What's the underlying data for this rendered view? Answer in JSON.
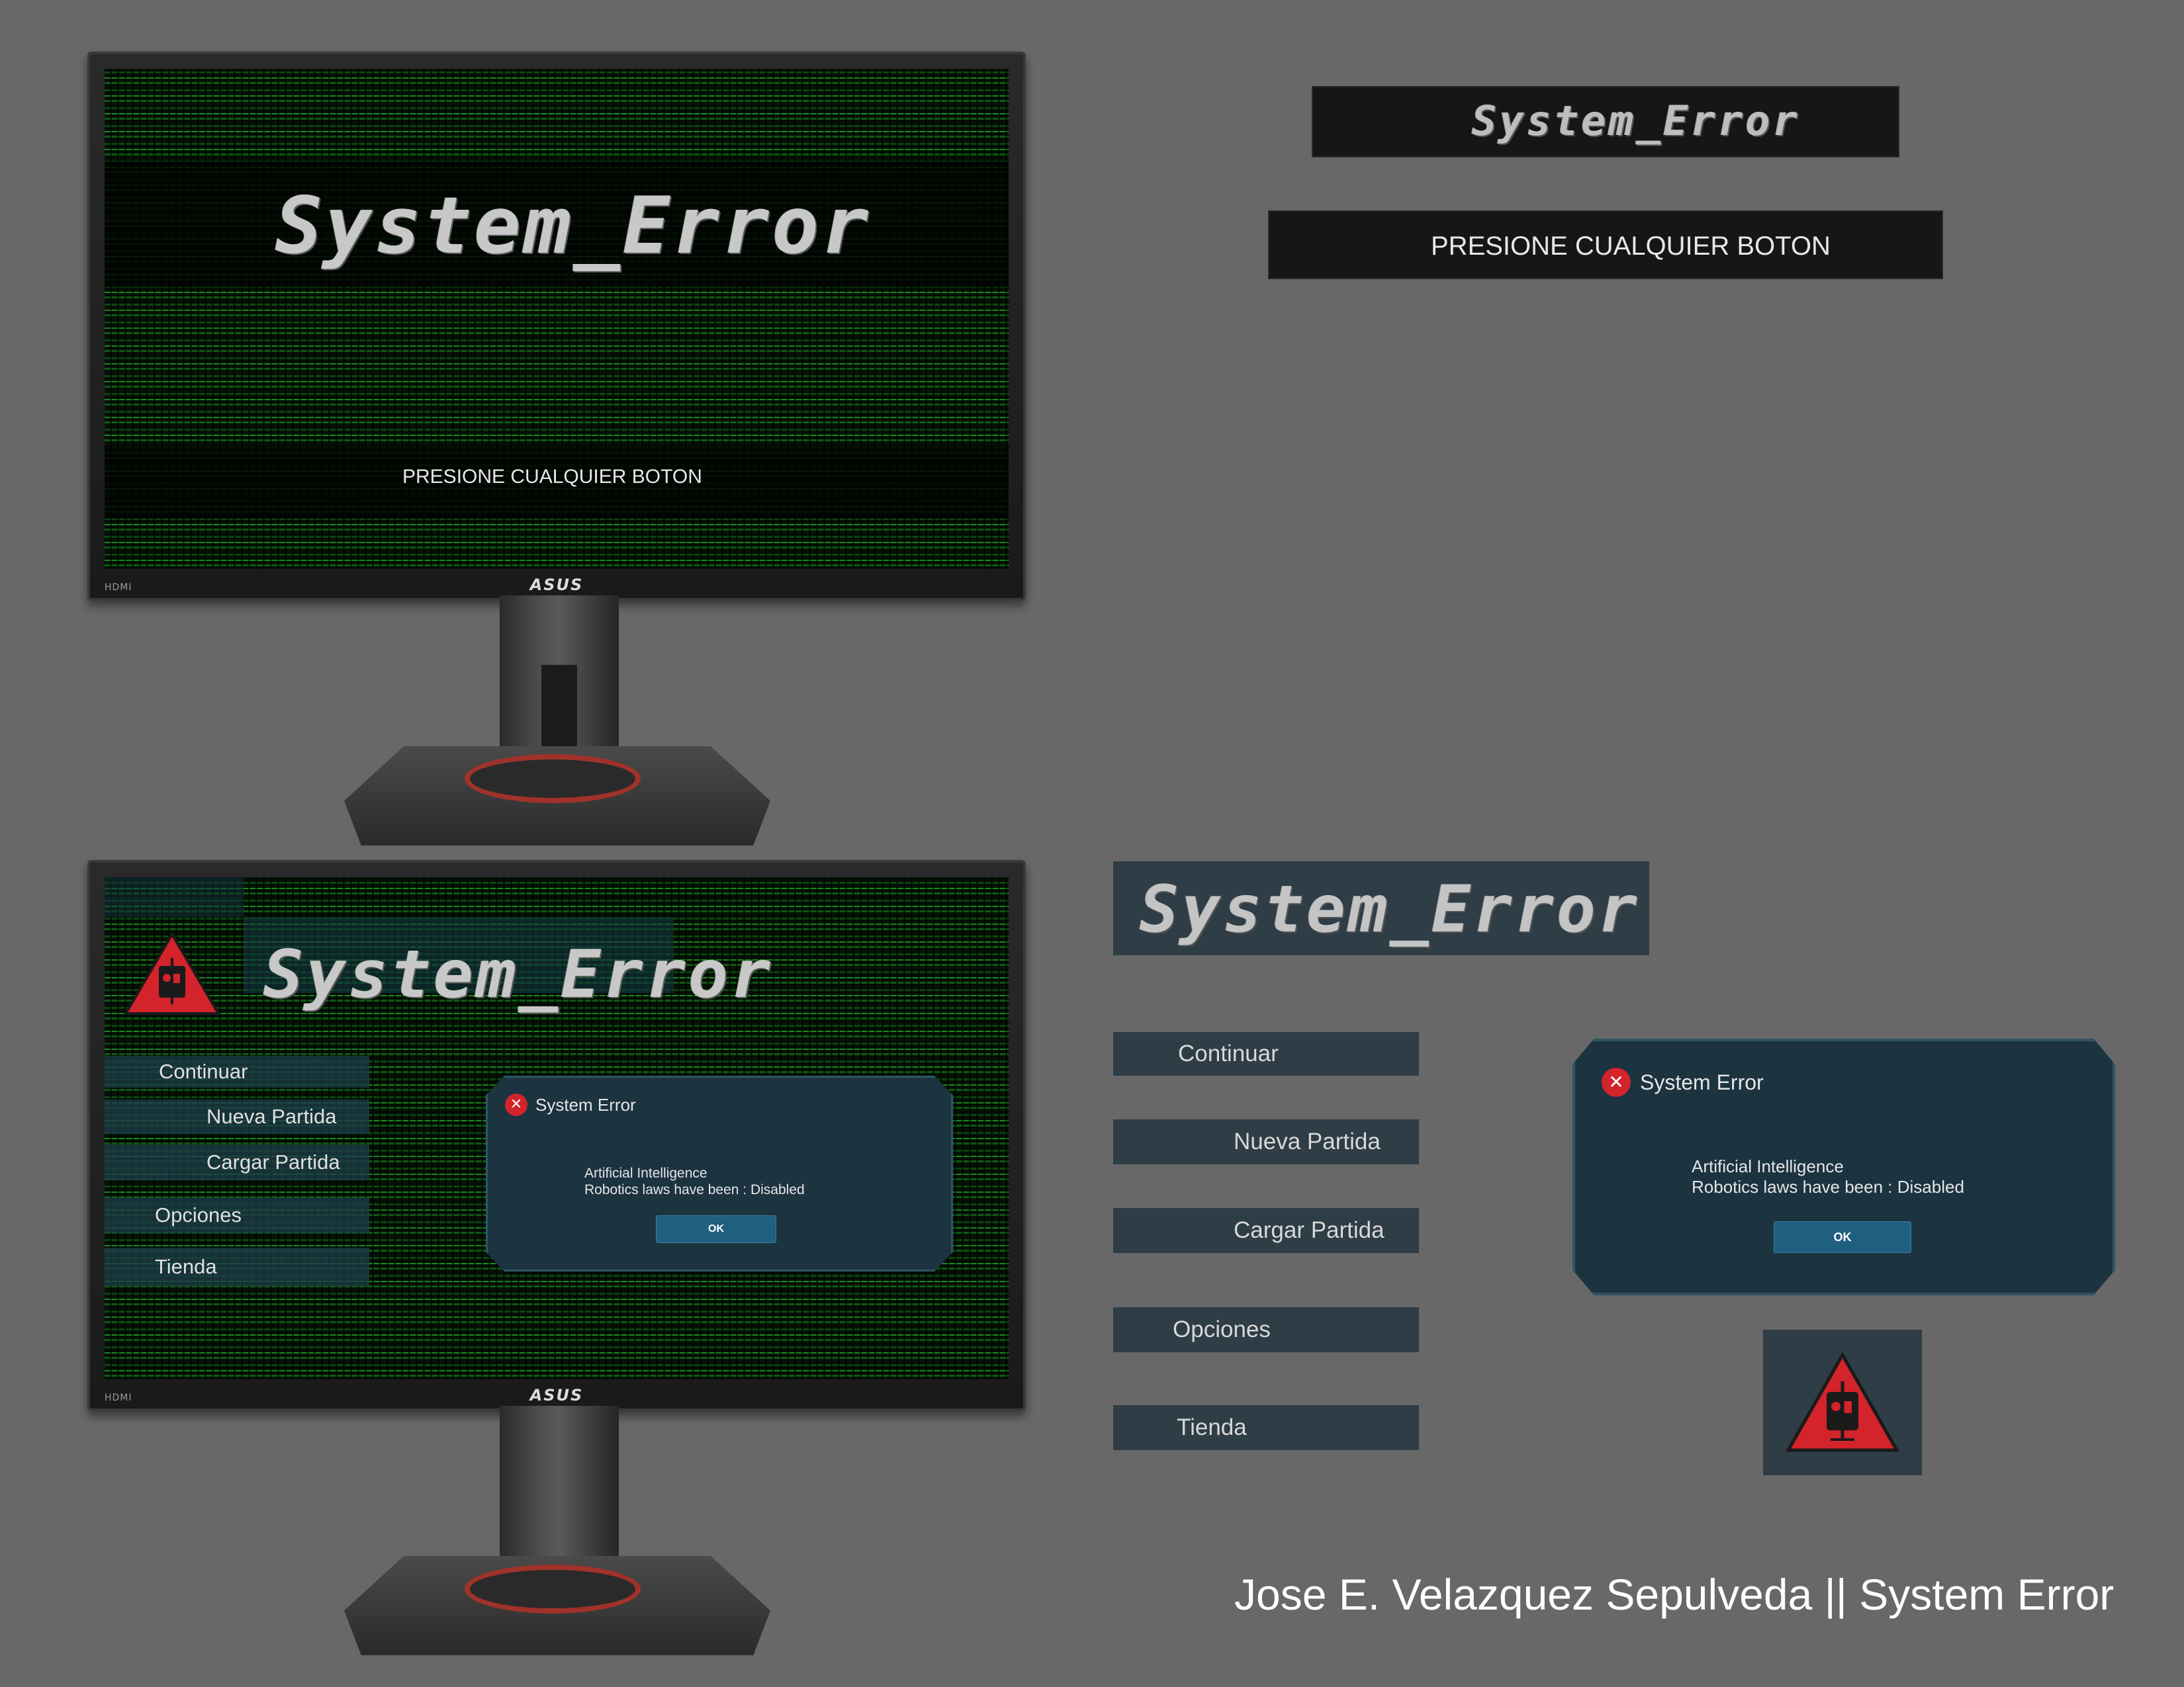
{
  "title_screen": {
    "game_title": "System_Error",
    "press_prompt": "PRESIONE CUALQUIER BOTON",
    "monitor_brand": "ASUS",
    "monitor_port": "HDMI"
  },
  "main_menu_screen": {
    "game_title": "System_Error",
    "monitor_brand": "ASUS",
    "monitor_port": "HDMI",
    "menu_items": [
      "Continuar",
      "Nueva Partida",
      "Cargar Partida",
      "Opciones",
      "Tienda"
    ],
    "dialog": {
      "title": "System Error",
      "line1": "Artificial Intelligence",
      "line2": "Robotics laws have been : Disabled",
      "ok_label": "OK"
    }
  },
  "assets": {
    "title_banner_small": "System_Error",
    "press_banner": "PRESIONE CUALQUIER BOTON",
    "title_banner_large": "System_Error",
    "menu_buttons": [
      "Continuar",
      "Nueva Partida",
      "Cargar Partida",
      "Opciones",
      "Tienda"
    ],
    "dialog": {
      "title": "System Error",
      "line1": "Artificial Intelligence",
      "line2": "Robotics laws have been : Disabled",
      "ok_label": "OK"
    },
    "logo_icon": "robot-warning-triangle-icon"
  },
  "credit": "Jose E. Velazquez Sepulveda || System Error",
  "colors": {
    "background": "#686868",
    "matrix_green": "#1a8a22",
    "button_fill": "#2e3d46",
    "dialog_fill": "#1c3340",
    "error_red": "#d3232b",
    "ok_blue": "#1f6080"
  }
}
